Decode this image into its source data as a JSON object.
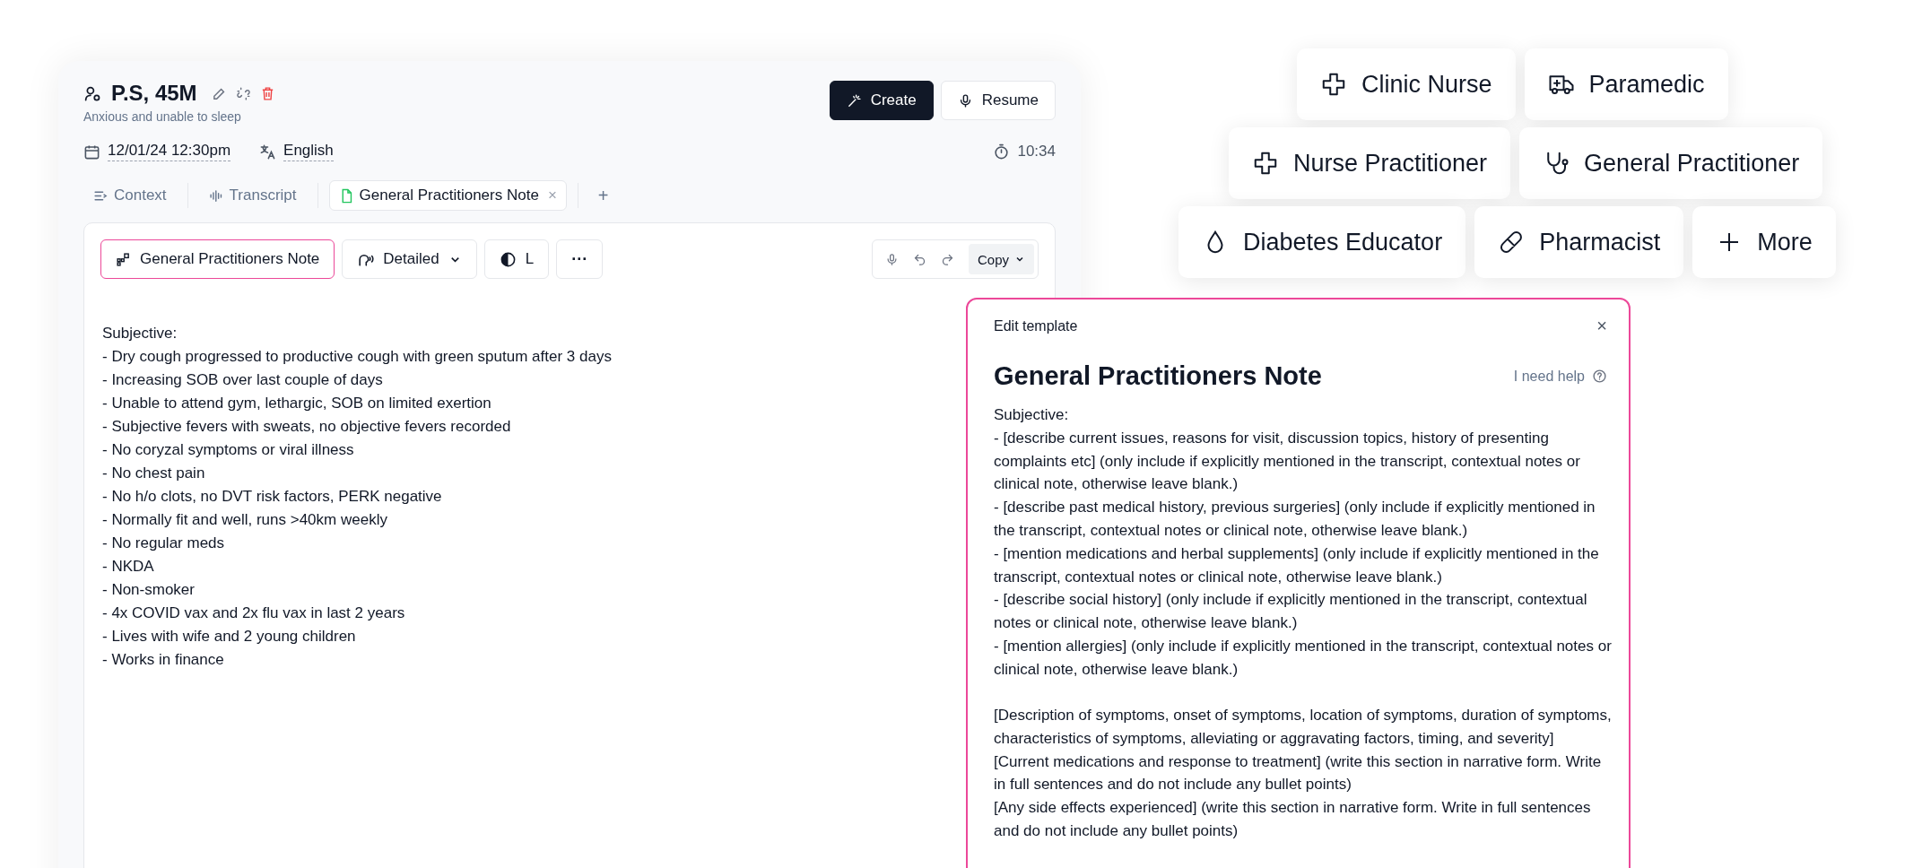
{
  "patient": {
    "name": "P.S, 45M",
    "summary": "Anxious and unable to sleep"
  },
  "actions": [
    {
      "label": "Create",
      "kind": "primary"
    },
    {
      "label": "Resume",
      "kind": "secondary"
    }
  ],
  "session": {
    "date": "12/01/24 12:30pm",
    "language": "English",
    "timer": "10:34"
  },
  "tabs": [
    {
      "label": "Context",
      "kind": "context",
      "selected": false
    },
    {
      "label": "Transcript",
      "kind": "transcript",
      "selected": false
    },
    {
      "label": "General Practitioners Note",
      "kind": "note",
      "selected": true,
      "close": "×"
    }
  ],
  "add_tab": "+",
  "toolbar": {
    "template": "General Practitioners Note",
    "detail": "Detailed",
    "size": "L",
    "more": "···",
    "copy": "Copy"
  },
  "note": {
    "lines": [
      "Subjective:",
      "- Dry cough progressed to productive cough with green sputum after 3 days",
      "- Increasing SOB over last couple of days",
      "- Unable to attend gym, lethargic, SOB on limited exertion",
      "- Subjective fevers with sweats, no objective fevers recorded",
      "- No coryzal symptoms or viral illness",
      "- No chest pain",
      "- No h/o clots, no DVT risk factors, PERK negative",
      "- Normally fit and well, runs >40km weekly",
      "- No regular meds",
      "- NKDA",
      "- Non-smoker",
      "- 4x COVID vax and 2x flu vax in last 2 years",
      "- Lives with wife and 2 young children",
      "- Works in finance"
    ]
  },
  "roles": [
    [
      {
        "label": "Clinic Nurse",
        "kind": "cross"
      },
      {
        "label": "Paramedic",
        "kind": "ambulance"
      }
    ],
    [
      {
        "label": "Nurse Practitioner",
        "kind": "cross"
      },
      {
        "label": "General Practitioner",
        "kind": "stethoscope"
      }
    ],
    [
      {
        "label": "Diabetes Educator",
        "kind": "drop"
      },
      {
        "label": "Pharmacist",
        "kind": "pill"
      },
      {
        "label": "More",
        "kind": "plus"
      }
    ]
  ],
  "template_editor": {
    "title": "Edit template",
    "close": "×",
    "name": "General Practitioners Note",
    "help": "I need help",
    "sections": [
      [
        "Subjective:",
        "- [describe current issues, reasons for visit, discussion topics, history of presenting complaints etc] (only include if explicitly mentioned in the transcript, contextual notes or clinical note, otherwise leave blank.)",
        "- [describe past medical history, previous surgeries] (only include if explicitly mentioned in the transcript, contextual notes or clinical note, otherwise leave blank.)",
        "- [mention medications and herbal supplements] (only include if explicitly mentioned in the transcript, contextual notes or clinical note, otherwise leave blank.)",
        "- [describe social history] (only include if explicitly mentioned in the transcript, contextual notes or clinical note, otherwise leave blank.)",
        "- [mention allergies] (only include if explicitly mentioned in the transcript, contextual notes or clinical note, otherwise leave blank.)"
      ],
      [
        "[Description of symptoms, onset of symptoms, location of symptoms, duration of symptoms, characteristics of symptoms, alleviating or aggravating factors, timing, and severity]",
        "[Current medications and response to treatment] (write this section in narrative form. Write in full sentences and do not include any bullet points)",
        "[Any side effects experienced] (write this section in narrative form. Write in full sentences and do not include any bullet points)"
      ]
    ]
  }
}
